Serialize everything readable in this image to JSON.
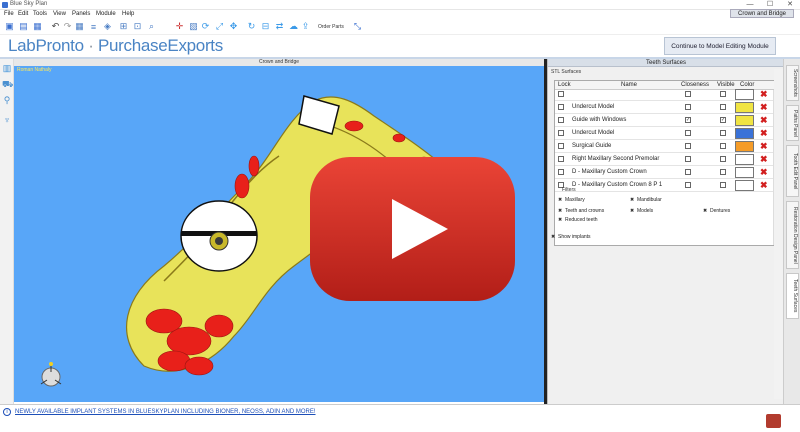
{
  "window": {
    "title": "Blue Sky Plan",
    "controls": [
      "—",
      "☐",
      "✕"
    ]
  },
  "menu": {
    "items": [
      "File",
      "Edit",
      "Tools",
      "View",
      "Panels",
      "Module",
      "Help"
    ],
    "mode_tab": "Crown and Bridge"
  },
  "toolbar": {
    "order_parts_label": "Order Parts"
  },
  "brand": {
    "part1": "LabPronto",
    "sep": " · ",
    "part2": "PurchaseExports",
    "continue_label": "Continue to Model Editing Module"
  },
  "viewport": {
    "header": "Crown and Bridge",
    "user": "Roman Nathaly"
  },
  "panel": {
    "title": "Teeth Surfaces",
    "stl_label": "STL Surfaces",
    "columns": {
      "lock": "Lock",
      "name": "Name",
      "closeness": "Closeness",
      "visible": "Visible",
      "color": "Color"
    },
    "rows": [
      {
        "name": "",
        "closeness": false,
        "visible": false,
        "color": "#ffffff"
      },
      {
        "name": "Undercut Model",
        "closeness": false,
        "visible": false,
        "color": "#f0e443"
      },
      {
        "name": "Guide with Windows",
        "closeness": true,
        "visible": true,
        "color": "#f0e443"
      },
      {
        "name": "Undercut Model",
        "closeness": false,
        "visible": false,
        "color": "#3a72d8"
      },
      {
        "name": "Surgical Guide",
        "closeness": false,
        "visible": false,
        "color": "#f59c28"
      },
      {
        "name": "Right Maxillary Second Premolar",
        "closeness": false,
        "visible": false,
        "color": "#ffffff"
      },
      {
        "name": "D - Maxillary Custom Crown",
        "closeness": false,
        "visible": false,
        "color": "#ffffff"
      },
      {
        "name": "D - Maxillary Custom Crown 8 P 1",
        "closeness": false,
        "visible": false,
        "color": "#ffffff"
      }
    ],
    "filters_label": "Filters",
    "filters": {
      "maxillary": "Maxillary",
      "mandibular": "Mandibular",
      "teeth_crowns": "Teeth and crowns",
      "models": "Models",
      "dentures": "Dentures",
      "reduced_teeth": "Reduced teeth"
    },
    "show_implants": "Show implants"
  },
  "right_tabs": [
    "Screenshots",
    "Paths Panel",
    "Tooth Edit Panel",
    "Restoration Design Panel",
    "Teeth Surfaces"
  ],
  "status": {
    "marquee": "NEWLY AVAILABLE IMPLANT SYSTEMS IN BLUESKYPLAN INCLUDING BIONER, NEOSS, ADIN AND MORE!"
  },
  "colors": {
    "viewport_bg": "#58a6f8",
    "tooth": "#e8e35a",
    "prep": "#e8201a",
    "yt_red": "#d42a22"
  },
  "icons": [
    "save-icon",
    "undo-icon",
    "redo-icon",
    "zoom-icon",
    "refresh-icon",
    "pan-icon",
    "rotate-icon",
    "cloud-icon",
    "upload-icon",
    "youtube-play-icon"
  ]
}
